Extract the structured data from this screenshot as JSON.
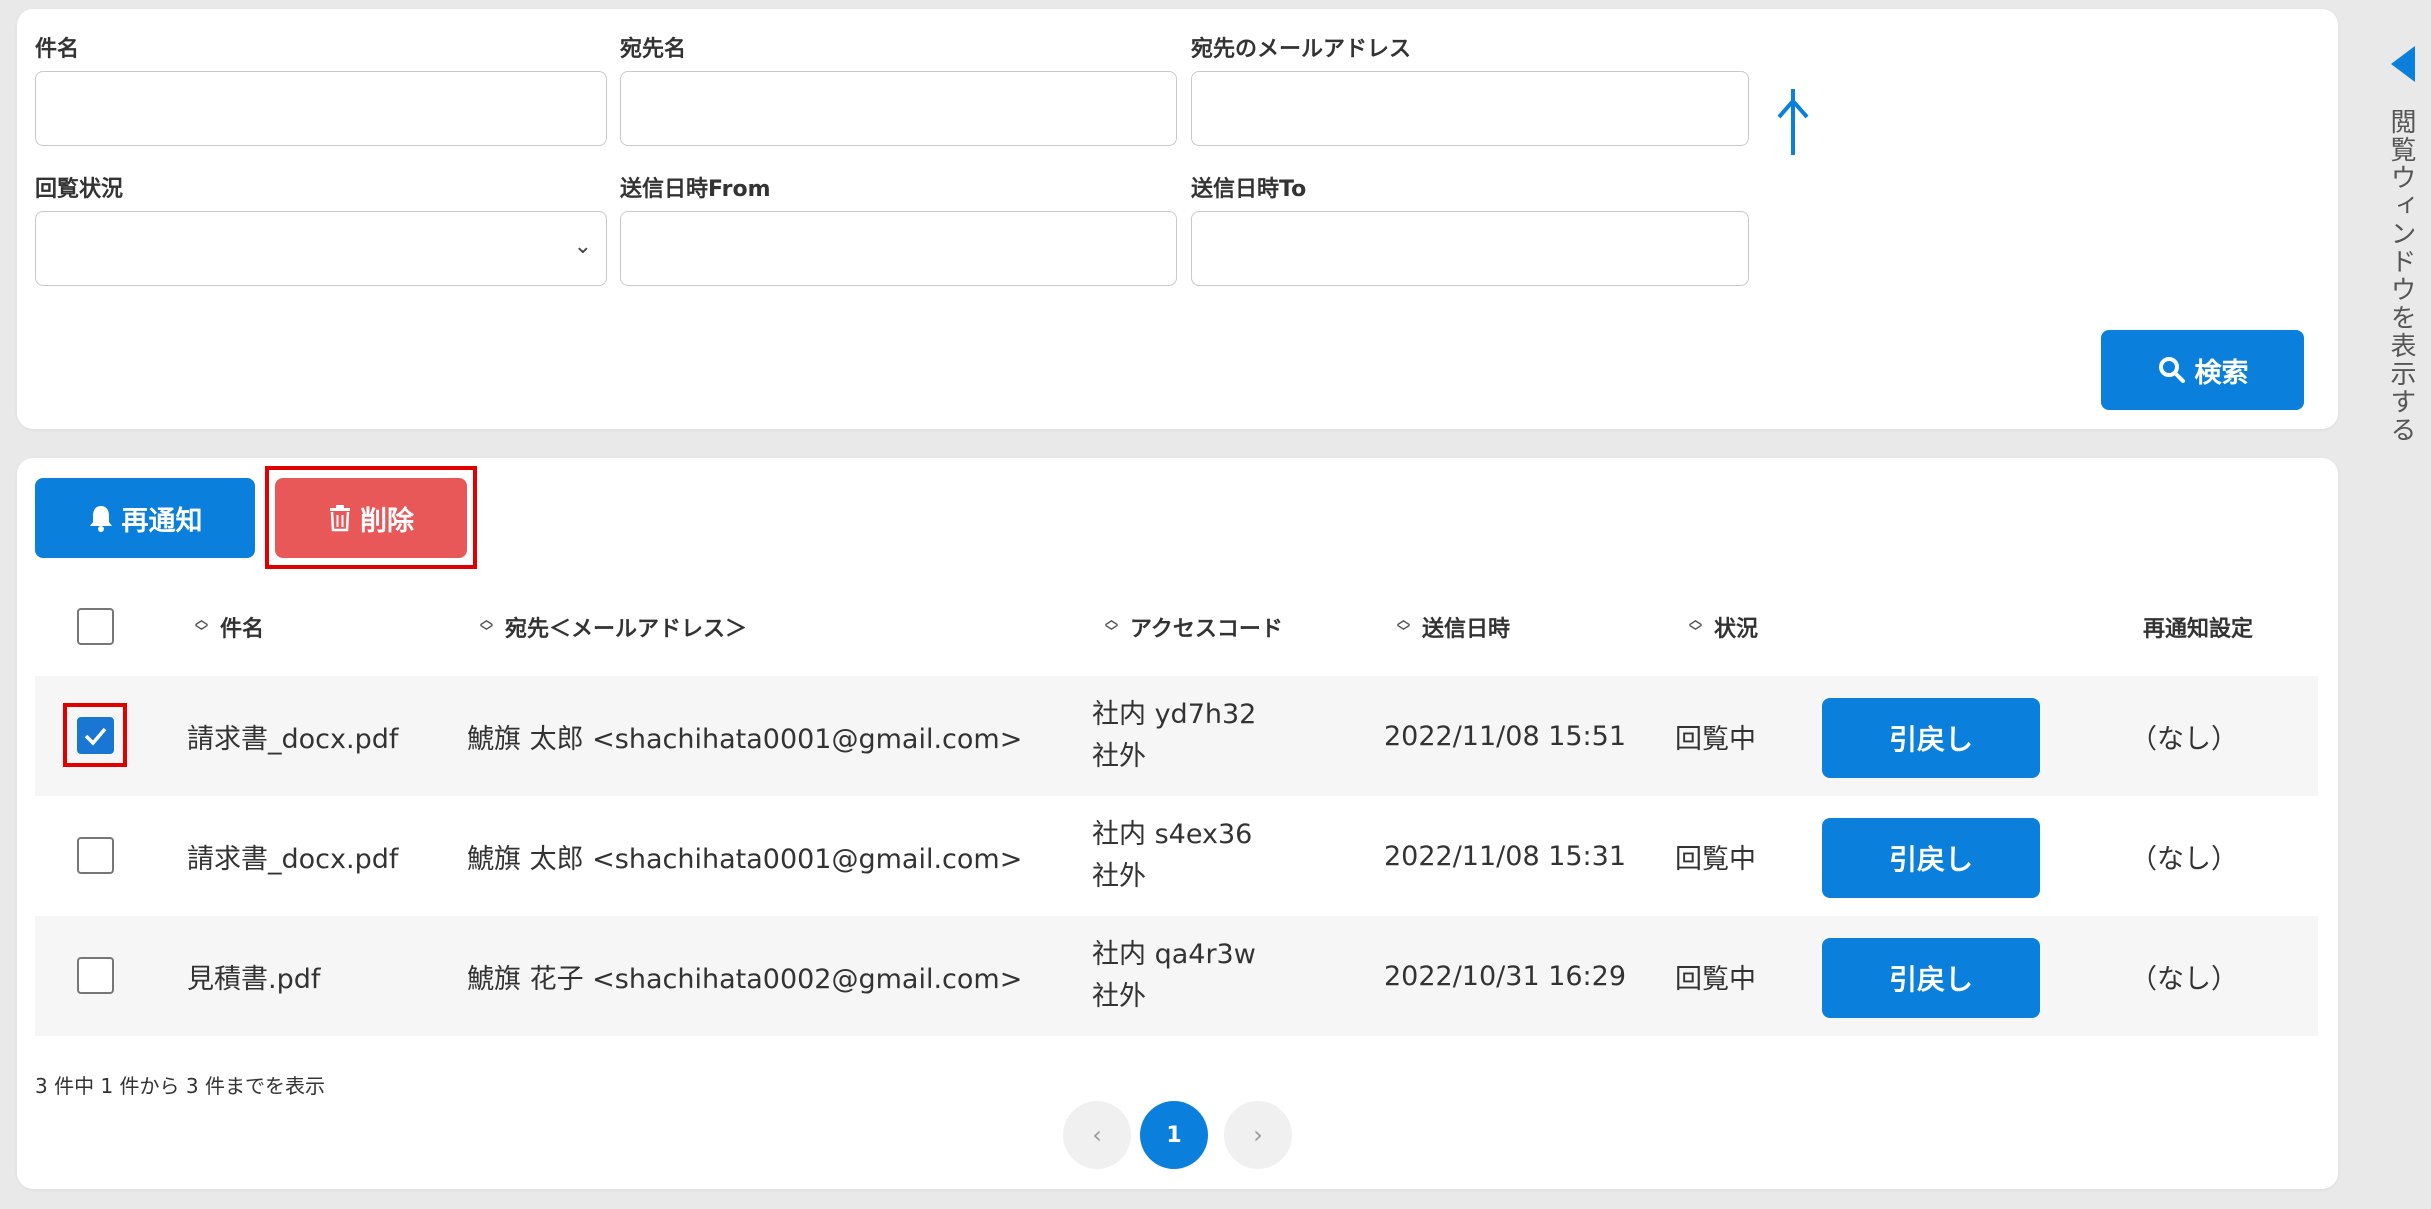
{
  "search": {
    "subject_label": "件名",
    "recipient_name_label": "宛先名",
    "recipient_email_label": "宛先のメールアドレス",
    "status_label": "回覧状況",
    "sent_from_label": "送信日時From",
    "sent_to_label": "送信日時To",
    "search_button_label": "検索"
  },
  "toolbar": {
    "renotify_label": "再通知",
    "delete_label": "削除"
  },
  "table": {
    "headers": {
      "subject": "件名",
      "recipient": "宛先＜メールアドレス＞",
      "access_code": "アクセスコード",
      "sent_at": "送信日時",
      "status": "状況",
      "renotify_setting": "再通知設定"
    },
    "rows": [
      {
        "checked": true,
        "subject": "請求書_docx.pdf",
        "recipient": "鯱旗 太郎 <shachihata0001@gmail.com>",
        "access_internal": "社内 yd7h32",
        "access_external": "社外",
        "sent_at": "2022/11/08 15:51",
        "status": "回覧中",
        "action_label": "引戻し",
        "renotify": "（なし）"
      },
      {
        "checked": false,
        "subject": "請求書_docx.pdf",
        "recipient": "鯱旗 太郎 <shachihata0001@gmail.com>",
        "access_internal": "社内 s4ex36",
        "access_external": "社外",
        "sent_at": "2022/11/08 15:31",
        "status": "回覧中",
        "action_label": "引戻し",
        "renotify": "（なし）"
      },
      {
        "checked": false,
        "subject": "見積書.pdf",
        "recipient": "鯱旗 花子 <shachihata0002@gmail.com>",
        "access_internal": "社内 qa4r3w",
        "access_external": "社外",
        "sent_at": "2022/10/31 16:29",
        "status": "回覧中",
        "action_label": "引戻し",
        "renotify": "（なし）"
      }
    ]
  },
  "pagination": {
    "summary": "3 件中 1 件から 3 件までを表示",
    "current_page": "1",
    "prev_symbol": "‹",
    "next_symbol": "›"
  },
  "side_panel": {
    "label": "閲覧ウィンドウを表示する"
  },
  "icons": {
    "collapse": "collapse-arrow-icon",
    "search": "search-icon",
    "bell": "bell-icon",
    "trash": "trash-icon",
    "sort": "sort-icon",
    "side_toggle": "caret-left-icon"
  },
  "colors": {
    "primary": "#0a7fdc",
    "danger": "#e85858",
    "highlight": "#e00000"
  }
}
